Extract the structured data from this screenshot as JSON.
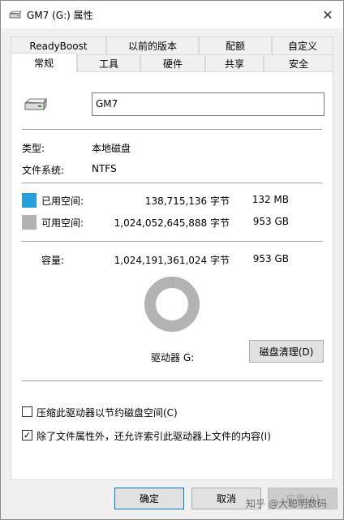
{
  "window": {
    "title": "GM7 (G:) 属性",
    "close_icon": "✕"
  },
  "tabs_row1": [
    {
      "label": "ReadyBoost",
      "width": 118
    },
    {
      "label": "以前的版本",
      "width": 114
    },
    {
      "label": "配额",
      "width": 90
    },
    {
      "label": "自定义",
      "width": 76
    }
  ],
  "tabs_row2": [
    {
      "label": "常规",
      "active": true
    },
    {
      "label": "工具"
    },
    {
      "label": "硬件"
    },
    {
      "label": "共享"
    },
    {
      "label": "安全"
    }
  ],
  "general": {
    "drive_name": "GM7",
    "type_label": "类型:",
    "type_value": "本地磁盘",
    "fs_label": "文件系统:",
    "fs_value": "NTFS",
    "used_label": "已用空间:",
    "used_bytes": "138,715,136 字节",
    "used_size": "132 MB",
    "free_label": "可用空间:",
    "free_bytes": "1,024,052,645,888 字节",
    "free_size": "953 GB",
    "capacity_label": "容量:",
    "capacity_bytes": "1,024,191,361,024 字节",
    "capacity_size": "953 GB",
    "drive_label": "驱动器 G:",
    "cleanup_button": "磁盘清理(D)",
    "compress_label": "压缩此驱动器以节约磁盘空间(C)",
    "compress_checked": false,
    "index_label": "除了文件属性外，还允许索引此驱动器上文件的内容(I)",
    "index_checked": true
  },
  "usage": {
    "used_fraction": 0.000135,
    "used_color": "#26a0da",
    "free_color": "#b3b3b3"
  },
  "buttons": {
    "ok": "确定",
    "cancel": "取消",
    "apply": "应用(A)"
  },
  "watermark": "知乎 @大聪明数码"
}
